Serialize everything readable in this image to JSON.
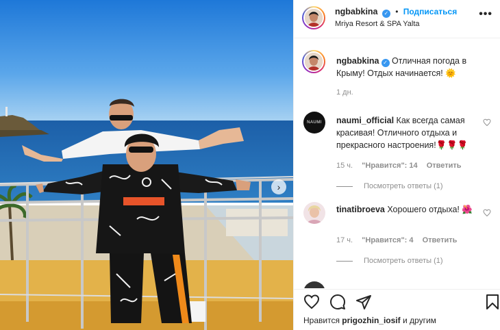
{
  "post": {
    "carousel_next_icon": "›"
  },
  "header": {
    "username": "ngbabkina",
    "verified_icon": "✓",
    "separator": "•",
    "follow_label": "Подписаться",
    "location": "Mriya Resort & SPA Yalta",
    "more_icon": "•••"
  },
  "caption": {
    "username": "ngbabkina",
    "text": "Отличная погода в Крыму! Отдых начинается!",
    "emoji": "🌞",
    "time": "1 дн."
  },
  "comments": [
    {
      "username": "naumi_official",
      "avatar_text": "NAUMI",
      "text": "Как всегда самая красивая! Отличного отдыха и прекрасного настроения!",
      "emoji": "🌹🌹🌹",
      "time": "15 ч.",
      "likes": "\"Нравится\": 14",
      "reply": "Ответить",
      "view_replies": "Посмотреть ответы (1)"
    },
    {
      "username": "tinatibroeva",
      "text": "Хорошего отдыха!",
      "emoji": "🌺",
      "time": "17 ч.",
      "likes": "\"Нравится\": 4",
      "reply": "Ответить",
      "view_replies": "Посмотреть ответы (1)"
    }
  ],
  "footer": {
    "liked_prefix": "Нравится",
    "liked_user": "prigozhin_iosif",
    "liked_suffix": "и другим"
  },
  "colors": {
    "accent": "#0095f6",
    "verified": "#3897f0",
    "secondary_text": "#8e8e8e",
    "border": "#efefef"
  }
}
